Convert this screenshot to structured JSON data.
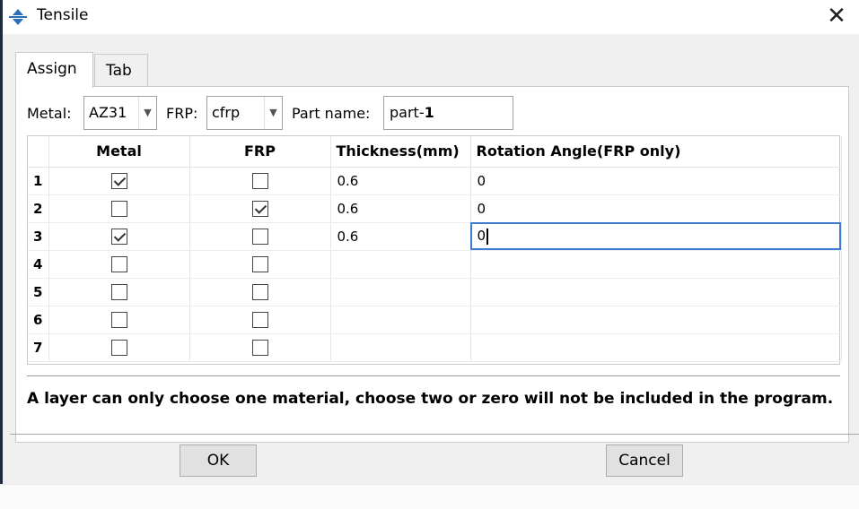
{
  "window": {
    "title": "Tensile",
    "close_glyph": "✕"
  },
  "tabs": [
    {
      "label": "Assign",
      "active": true
    },
    {
      "label": "Tab",
      "active": false
    }
  ],
  "options": {
    "metal_label": "Metal:",
    "metal_value": "AZ31",
    "frp_label": "FRP:",
    "frp_value": "cfrp",
    "part_label": "Part name:",
    "part_value_prefix": "part-",
    "part_value_suffix": "1"
  },
  "table": {
    "headers": [
      "",
      "Metal",
      "FRP",
      "Thickness(mm)",
      "Rotation Angle(FRP only)"
    ],
    "rows": [
      {
        "n": "1",
        "metal": true,
        "frp": false,
        "thickness": "0.6",
        "angle": "0"
      },
      {
        "n": "2",
        "metal": false,
        "frp": true,
        "thickness": "0.6",
        "angle": "0"
      },
      {
        "n": "3",
        "metal": true,
        "frp": false,
        "thickness": "0.6",
        "angle": "0"
      },
      {
        "n": "4",
        "metal": false,
        "frp": false,
        "thickness": "",
        "angle": ""
      },
      {
        "n": "5",
        "metal": false,
        "frp": false,
        "thickness": "",
        "angle": ""
      },
      {
        "n": "6",
        "metal": false,
        "frp": false,
        "thickness": "",
        "angle": ""
      },
      {
        "n": "7",
        "metal": false,
        "frp": false,
        "thickness": "",
        "angle": ""
      }
    ]
  },
  "note": "A layer can only choose one material, choose two or zero will not be included in the program.",
  "buttons": {
    "ok": "OK",
    "cancel": "Cancel"
  },
  "colors": {
    "accent": "#3d7bd1",
    "icon": "#2c6fb8"
  }
}
